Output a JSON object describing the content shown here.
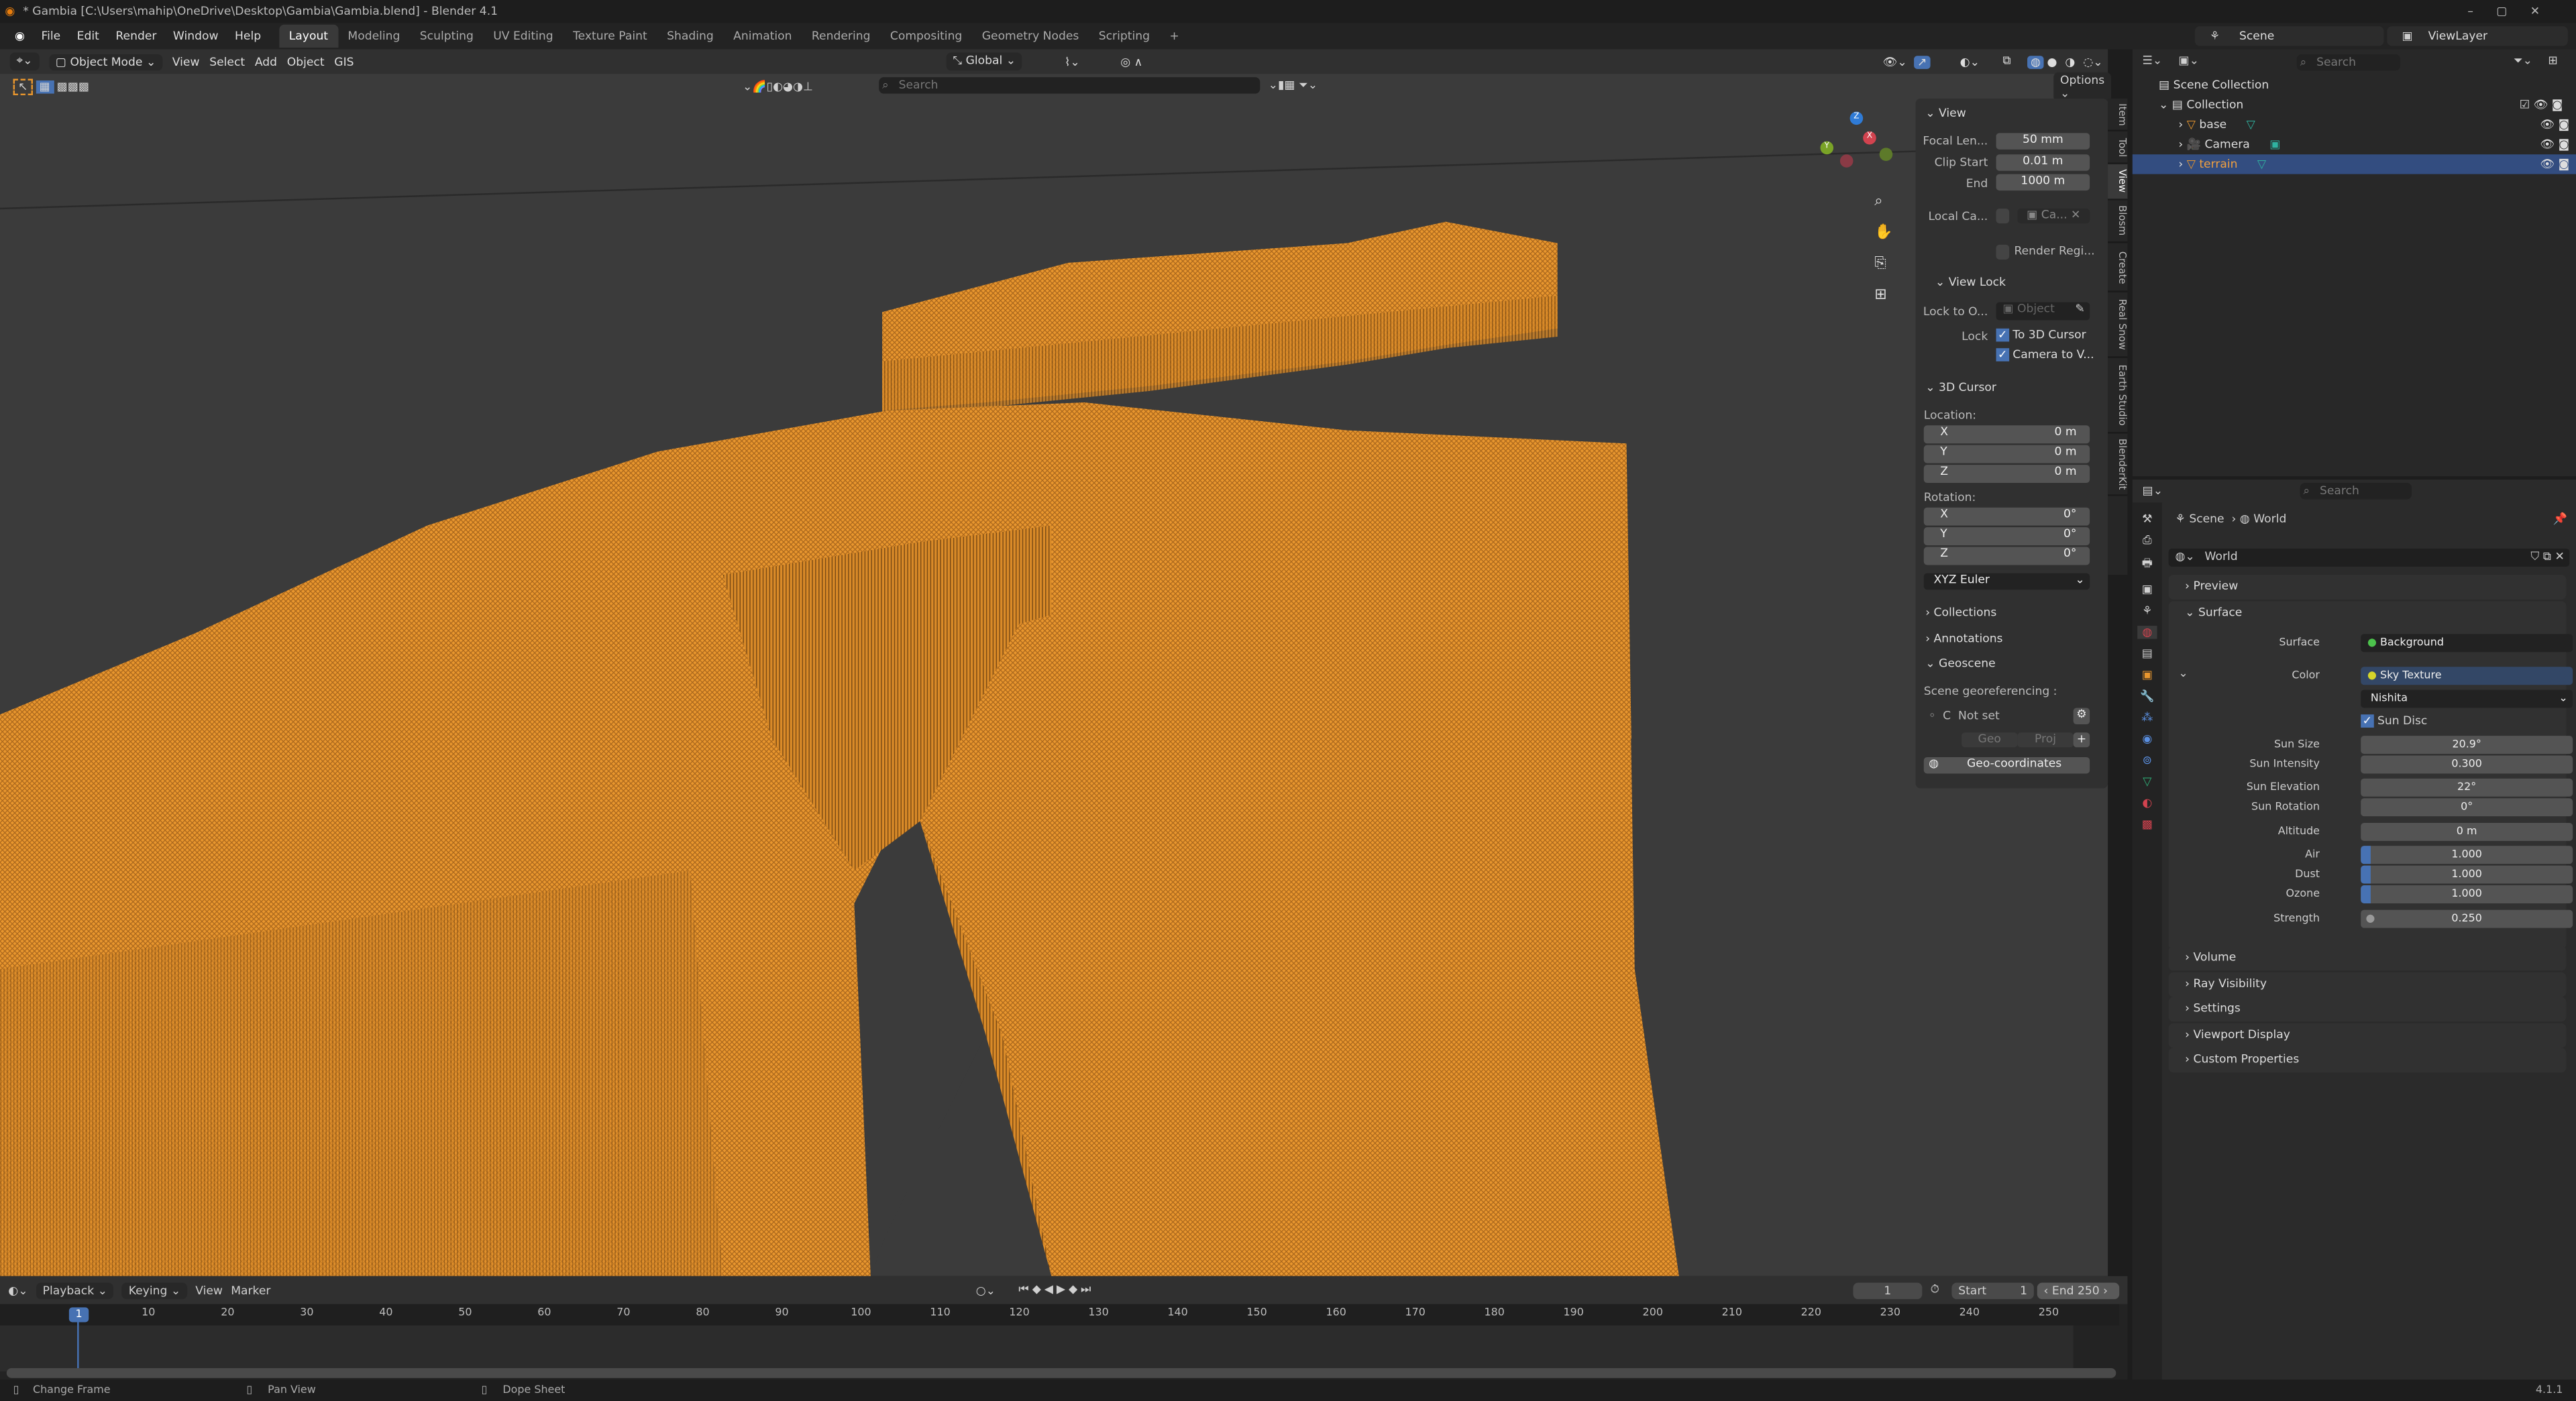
{
  "window": {
    "title": "* Gambia [C:\\Users\\mahip\\OneDrive\\Desktop\\Gambia\\Gambia.blend] - Blender 4.1",
    "version": "4.1.1"
  },
  "menu": [
    "File",
    "Edit",
    "Render",
    "Window",
    "Help"
  ],
  "workspaces": [
    "Layout",
    "Modeling",
    "Sculpting",
    "UV Editing",
    "Texture Paint",
    "Shading",
    "Animation",
    "Rendering",
    "Compositing",
    "Geometry Nodes",
    "Scripting"
  ],
  "active_workspace": "Layout",
  "viewport_header": {
    "mode": "Object Mode",
    "menus": [
      "View",
      "Select",
      "Add",
      "Object",
      "GIS"
    ],
    "orientation": "Global",
    "search_placeholder": "Search",
    "options": "Options"
  },
  "npanel": {
    "tabs": [
      "Item",
      "Tool",
      "View",
      "Blosm",
      "Create",
      "Real Snow",
      "Earth Studio",
      "BlenderKit"
    ],
    "active_tab": "View",
    "view": {
      "title": "View",
      "focal_label": "Focal Len...",
      "focal": "50 mm",
      "clip_start_label": "Clip Start",
      "clip_start": "0.01 m",
      "end_label": "End",
      "end": "1000 m",
      "local_cam_label": "Local Ca...",
      "local_cam_value": "Ca...",
      "render_region": "Render Regi..."
    },
    "view_lock": {
      "title": "View Lock",
      "lock_to_label": "Lock to O...",
      "lock_to_placeholder": "Object",
      "lock_label": "Lock",
      "to_cursor": "To 3D Cursor",
      "camera_to_view": "Camera to V..."
    },
    "cursor": {
      "title": "3D Cursor",
      "location_label": "Location:",
      "loc": [
        {
          "axis": "X",
          "value": "0 m"
        },
        {
          "axis": "Y",
          "value": "0 m"
        },
        {
          "axis": "Z",
          "value": "0 m"
        }
      ],
      "rotation_label": "Rotation:",
      "rot": [
        {
          "axis": "X",
          "value": "0°"
        },
        {
          "axis": "Y",
          "value": "0°"
        },
        {
          "axis": "Z",
          "value": "0°"
        }
      ],
      "mode": "XYZ Euler"
    },
    "collections": "Collections",
    "annotations": "Annotations",
    "geoscene": {
      "title": "Geoscene",
      "label": "Scene georeferencing :",
      "crs_prefix": "C",
      "crs": "Not set",
      "geo": "Geo",
      "proj": "Proj",
      "geo_coords": "Geo-coordinates"
    }
  },
  "topbar_right": {
    "scene": "Scene",
    "view_layer": "ViewLayer"
  },
  "outliner": {
    "search_placeholder": "Search",
    "root": "Scene Collection",
    "collection": "Collection",
    "items": [
      {
        "name": "base",
        "selected": false
      },
      {
        "name": "Camera",
        "selected": false
      },
      {
        "name": "terrain",
        "selected": true
      }
    ]
  },
  "properties": {
    "search_placeholder": "Search",
    "breadcrumb": [
      "Scene",
      "World"
    ],
    "world_name": "World",
    "panels": {
      "preview": "Preview",
      "surface": "Surface",
      "volume": "Volume",
      "ray_visibility": "Ray Visibility",
      "settings": "Settings",
      "viewport_display": "Viewport Display",
      "custom_properties": "Custom Properties"
    },
    "surface": {
      "surface_label": "Surface",
      "surface_value": "Background",
      "color_label": "Color",
      "color_value": "Sky Texture",
      "sky_type": "Nishita",
      "sun_disc": "Sun Disc",
      "fields": [
        {
          "label": "Sun Size",
          "value": "20.9°"
        },
        {
          "label": "Sun Intensity",
          "value": "0.300"
        },
        {
          "label": "Sun Elevation",
          "value": "22°"
        },
        {
          "label": "Sun Rotation",
          "value": "0°"
        },
        {
          "label": "Altitude",
          "value": "0 m"
        },
        {
          "label": "Air",
          "value": "1.000"
        },
        {
          "label": "Dust",
          "value": "1.000"
        },
        {
          "label": "Ozone",
          "value": "1.000"
        },
        {
          "label": "Strength",
          "value": "0.250"
        }
      ]
    }
  },
  "timeline": {
    "menus": [
      "Playback",
      "Keying",
      "View",
      "Marker"
    ],
    "current_frame": "1",
    "start_label": "Start",
    "start": "1",
    "end_label": "End",
    "end": "250",
    "ticks": [
      "10",
      "20",
      "30",
      "40",
      "50",
      "60",
      "70",
      "80",
      "90",
      "100",
      "110",
      "120",
      "130",
      "140",
      "150",
      "160",
      "170",
      "180",
      "190",
      "200",
      "210",
      "220",
      "230",
      "240",
      "250"
    ]
  },
  "status": {
    "items": [
      "Change Frame",
      "Pan View",
      "Dope Sheet"
    ]
  },
  "colors": {
    "accent": "#4772b3",
    "terrain": "#e8962e",
    "bg": "#3b3b3b"
  }
}
